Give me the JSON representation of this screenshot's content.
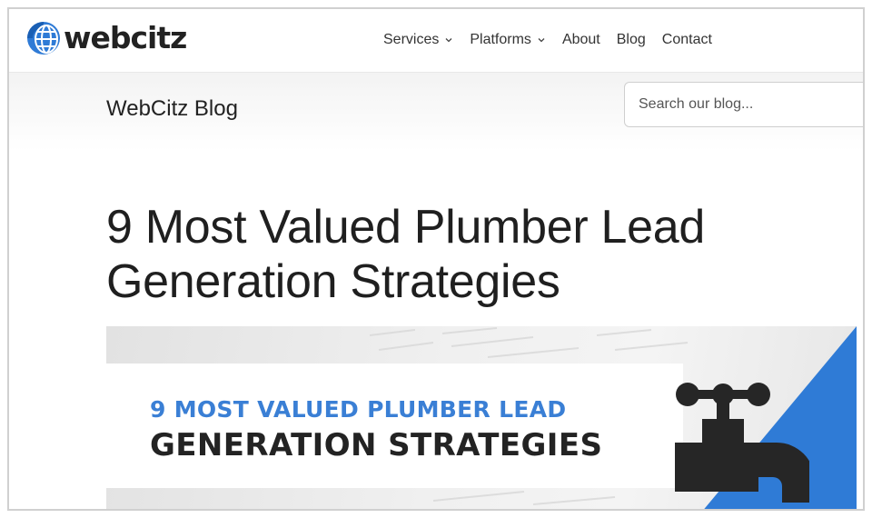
{
  "brand": {
    "name": "webcitz"
  },
  "nav": {
    "items": [
      {
        "label": "Services",
        "dropdown": true
      },
      {
        "label": "Platforms",
        "dropdown": true
      },
      {
        "label": "About",
        "dropdown": false
      },
      {
        "label": "Blog",
        "dropdown": false
      },
      {
        "label": "Contact",
        "dropdown": false
      }
    ]
  },
  "blog": {
    "title": "WebCitz Blog",
    "search_placeholder": "Search our blog..."
  },
  "article": {
    "title": "9 Most Valued Plumber Lead Generation Strategies"
  },
  "hero": {
    "line1": "9 MOST VALUED PLUMBER LEAD",
    "line2": "GENERATION STRATEGIES",
    "icon": "faucet-icon"
  },
  "colors": {
    "accent_blue": "#2f7bd6",
    "text_dark": "#222222"
  }
}
